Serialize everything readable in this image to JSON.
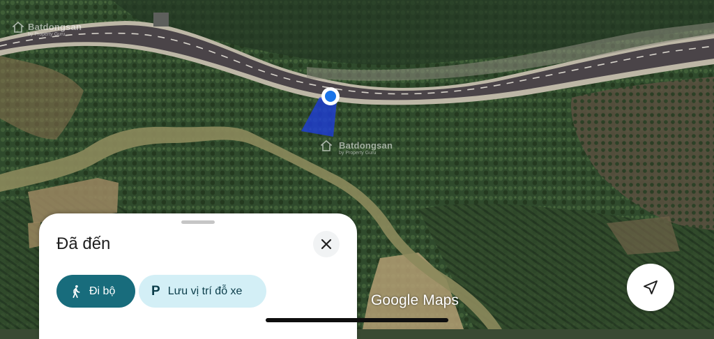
{
  "map": {
    "watermark_brand": "Batdongsan",
    "watermark_sub": "by Property Guru",
    "provider_logo": "Google Maps"
  },
  "sheet": {
    "title": "Đã đến",
    "close_icon": "close-icon",
    "actions": [
      {
        "label": "Đi bộ",
        "icon": "walk-icon"
      },
      {
        "label": "Lưu vị trí đỗ xe",
        "icon": "parking-icon",
        "icon_text": "P"
      }
    ]
  },
  "controls": {
    "recenter_icon": "navigation-arrow-icon"
  },
  "colors": {
    "accent": "#186c7c",
    "chip_light": "#d3eff6",
    "location_dot": "#1a73e8",
    "parcel": "#1e3cd8"
  }
}
